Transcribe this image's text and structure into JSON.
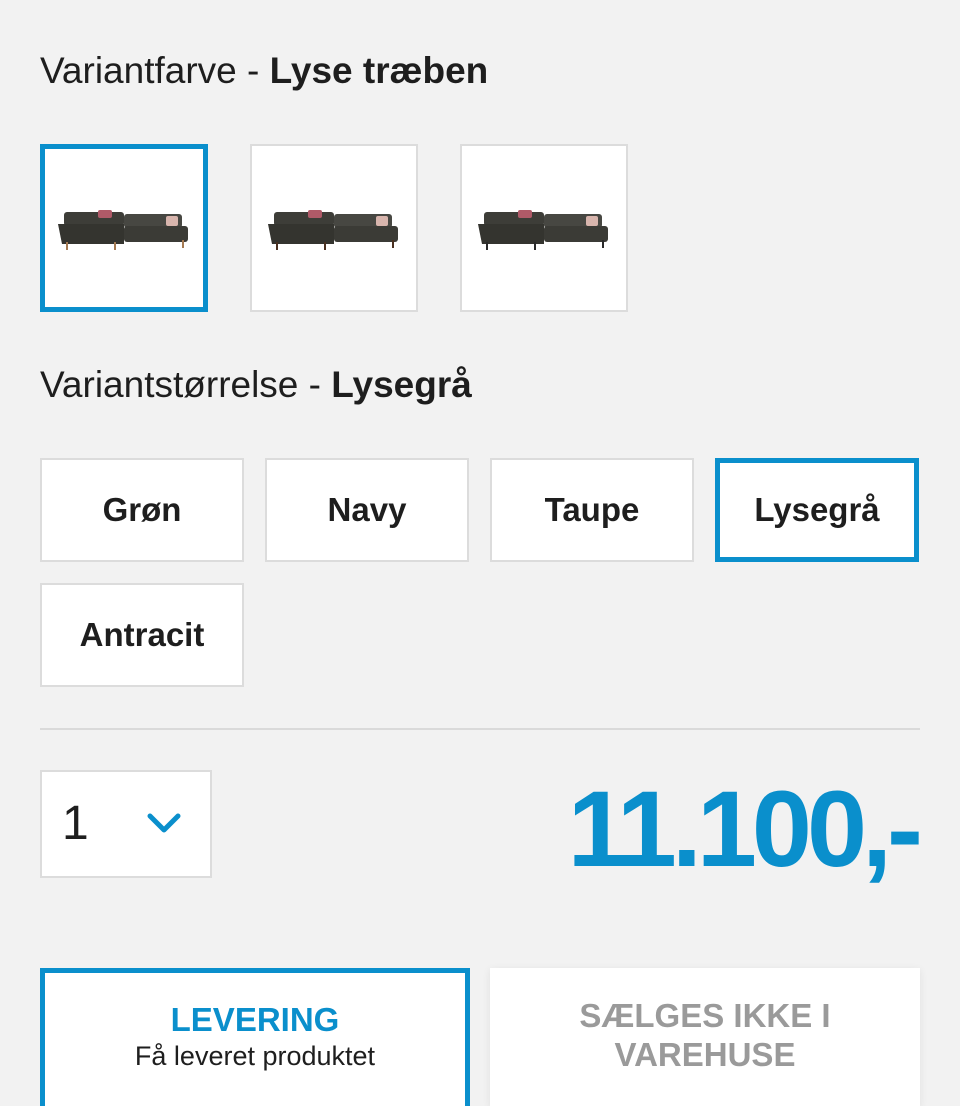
{
  "variant_color": {
    "label": "Variantfarve",
    "separator": " - ",
    "value": "Lyse træben",
    "swatches": [
      {
        "name": "sofa-swatch-1",
        "selected": true
      },
      {
        "name": "sofa-swatch-2",
        "selected": false
      },
      {
        "name": "sofa-swatch-3",
        "selected": false
      }
    ]
  },
  "variant_size": {
    "label": "Variantstørrelse",
    "separator": " - ",
    "value": "Lysegrå",
    "options": [
      "Grøn",
      "Navy",
      "Taupe",
      "Lysegrå",
      "Antracit"
    ],
    "selected": "Lysegrå"
  },
  "quantity": {
    "value": "1",
    "icon": "chevron-down-icon"
  },
  "price": "11.100,-",
  "delivery": {
    "title": "LEVERING",
    "subtitle": "Få leveret produktet"
  },
  "store": {
    "title": "SÆLGES IKKE I VAREHUSE"
  },
  "colors": {
    "accent": "#0a8fcc",
    "background": "#f2f2f2",
    "disabled_text": "#9a9a9a"
  }
}
